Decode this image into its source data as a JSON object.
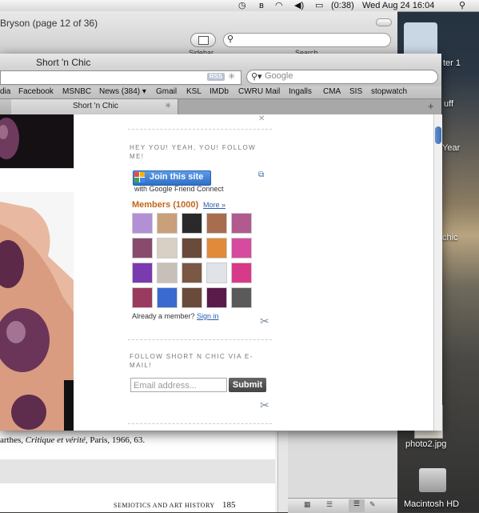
{
  "menubar": {
    "time_machine_icon": "clock-icon",
    "bluetooth_icon": "bluetooth-icon",
    "wifi_icon": "wifi-icon",
    "volume_icon": "speaker-icon",
    "battery": "(0:38)",
    "datetime": "Wed Aug 24  16:04",
    "spotlight_icon": "magnifier-icon"
  },
  "doc_window": {
    "title": "Bryson (page 12 of 36)",
    "sidebar_label": "Sidebar",
    "search_label": "Search",
    "caption_text": "arthes, Critique et vérité, Paris, 1966, 63.",
    "caption_prefix": "arthes, ",
    "caption_italic": "Critique et vérité",
    "caption_suffix": ", Paris, 1966, 63.",
    "footer": "SEMIOTICS AND ART HISTORY",
    "page_number": "185"
  },
  "desktop": {
    "items": [
      {
        "label": "ter 1"
      },
      {
        "label": "uff"
      },
      {
        "label": "Year"
      },
      {
        "label": "chic"
      },
      {
        "label": "photo2.jpg"
      },
      {
        "label": "Macintosh HD"
      }
    ]
  },
  "browser": {
    "title": "Short 'n Chic",
    "rss_label": "RSS",
    "search_placeholder": "Google",
    "bookmarks": [
      "dia",
      "Facebook",
      "MSNBC",
      "News (384) ▾",
      "Gmail",
      "KSL",
      "IMDb",
      "CWRU Mail",
      "Ingalls",
      "CMA",
      "SIS",
      "stopwatch"
    ],
    "active_tab": "Short 'n Chic",
    "new_tab": "+"
  },
  "follow_widget": {
    "title": "HEY YOU! YEAH, YOU! FOLLOW ME!",
    "join_label": "Join this site",
    "gfc_text": "with Google Friend Connect",
    "members_label": "Members (1000)",
    "more_label": "More »",
    "already_text": "Already a member? ",
    "sign_in": "Sign in",
    "avatar_colors": [
      "#b38fd6",
      "#c9a07a",
      "#2a2a2a",
      "#a86d4e",
      "#b05a8e",
      "#8a4a6e",
      "#d8d0c4",
      "#6a4a3a",
      "#e08a3a",
      "#d64aa0",
      "#7a3ab0",
      "#c8c0b8",
      "#7a5844",
      "#e0e4e8",
      "#d83a8a",
      "#9a3a5e",
      "#3a6ad0",
      "#6a4a3a",
      "#5a1a4a",
      "#5a5a5a"
    ]
  },
  "email_widget": {
    "title": "FOLLOW SHORT N CHIC VIA E-MAIL!",
    "placeholder": "Email address...",
    "submit_label": "Submit"
  }
}
